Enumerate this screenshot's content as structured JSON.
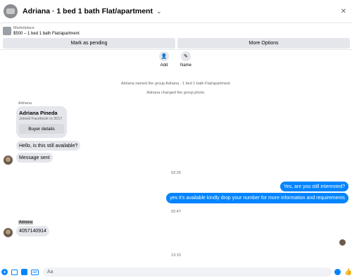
{
  "header": {
    "title": "Adriana · 1 bed 1 bath Flat/apartment",
    "chevron": "⌄",
    "close": "✕"
  },
  "marketplace": {
    "label": "Marketplace",
    "item": "$500 – 1 bed 1 bath Flat/apartment"
  },
  "actions": {
    "pending": "Mark as pending",
    "more": "More Options"
  },
  "quick": [
    {
      "label": "Add",
      "icon": "add-person-icon",
      "glyph": "👤"
    },
    {
      "label": "Name",
      "icon": "pencil-icon",
      "glyph": "✎"
    }
  ],
  "system": [
    "Adriana named the group Adriana · 1 bed 1 bath Flat/apartment.",
    "Adriana changed the group photo."
  ],
  "card": {
    "sender": "Adriana",
    "name": "Adriana Pineda",
    "joined": "Joined Facebook in 2017",
    "button": "Buyer details"
  },
  "messages": {
    "in1": "Hello, is this still available?",
    "in2": "Message sent",
    "time1": "02:25",
    "out1": "Yes, are you still interested?",
    "out2": "yes it's available kindly drop your number for more information and requirements",
    "time2": "02:47",
    "sender2": "Adriana",
    "in3": "4057140914",
    "time3": "13:15"
  },
  "composer": {
    "placeholder": "Aa"
  },
  "colors": {
    "accent": "#0084ff",
    "bubble_in": "#e4e6eb"
  }
}
